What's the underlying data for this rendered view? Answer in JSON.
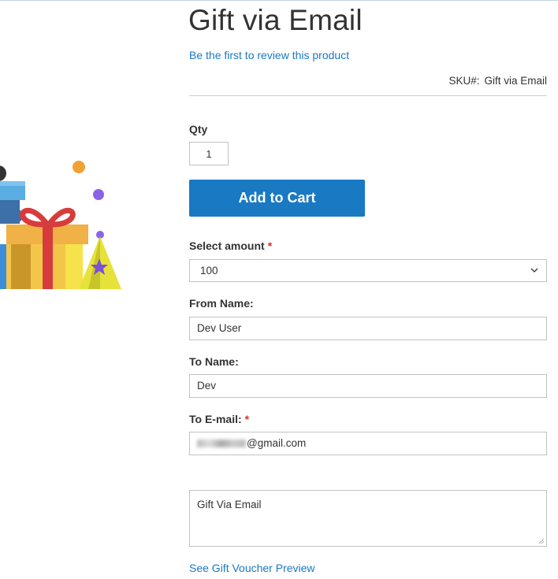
{
  "product": {
    "title": "Gift via Email",
    "review_link": "Be the first to review this product",
    "sku_label": "SKU#:",
    "sku_value": "Gift via Email"
  },
  "form": {
    "qty_label": "Qty",
    "qty_value": "1",
    "add_to_cart": "Add to Cart",
    "amount_label": "Select amount",
    "amount_value": "100",
    "from_label": "From Name:",
    "from_value": "Dev User",
    "to_label": "To Name:",
    "to_value": "Dev",
    "email_label": "To E-mail:",
    "email_value_visible": "@gmail.com",
    "message_value": "Gift Via Email",
    "required_mark": "*",
    "preview_link": "See Gift Voucher Preview"
  },
  "colors": {
    "accent": "#1979c3",
    "required": "#e02b27"
  }
}
